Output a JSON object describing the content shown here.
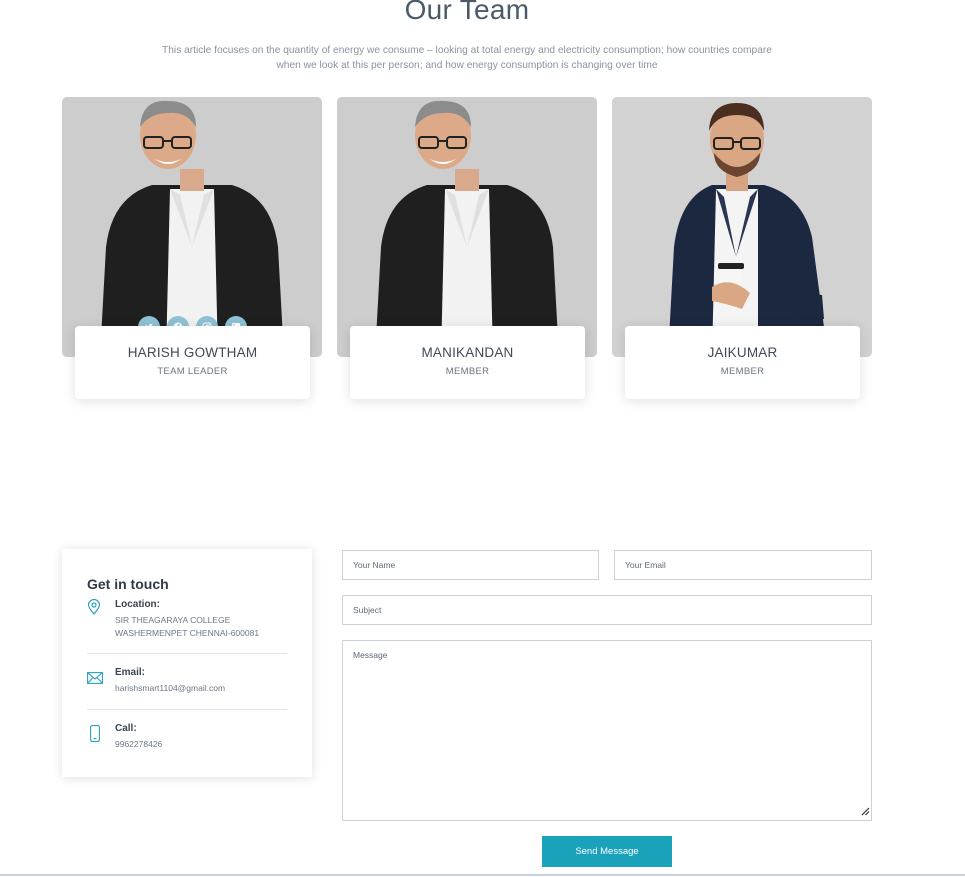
{
  "team": {
    "title": "Our Team",
    "description_line1": "This article focuses on the quantity of energy we consume – looking at total energy and electricity consumption; how countries compare",
    "description_line2": "when we look at this per person; and how energy consumption is changing over time",
    "members": [
      {
        "name": "HARISH GOWTHAM",
        "role": "TEAM LEADER",
        "socials": [
          "twitter-icon",
          "facebook-icon",
          "instagram-icon",
          "linkedin-icon"
        ]
      },
      {
        "name": "MANIKANDAN",
        "role": "MEMBER"
      },
      {
        "name": "JAIKUMAR",
        "role": "MEMBER"
      }
    ]
  },
  "contact": {
    "heading": "Get in touch",
    "location": {
      "label": "Location:",
      "line1": "SIR THEAGARAYA COLLEGE",
      "line2": "WASHERMENPET CHENNAI-600081",
      "icon": "map-pin-icon"
    },
    "email": {
      "label": "Email:",
      "value": "harishsmart1104@gmail.com",
      "icon": "envelope-icon"
    },
    "call": {
      "label": "Call:",
      "value": "9962278426",
      "icon": "phone-icon"
    }
  },
  "form": {
    "name_placeholder": "Your Name",
    "email_placeholder": "Your Email",
    "subject_placeholder": "Subject",
    "message_placeholder": "Message",
    "submit_label": "Send Message"
  },
  "colors": {
    "accent": "#1aa2bb",
    "social_icon_bg": "#8fc2d6",
    "heading": "#4b5a6a"
  }
}
